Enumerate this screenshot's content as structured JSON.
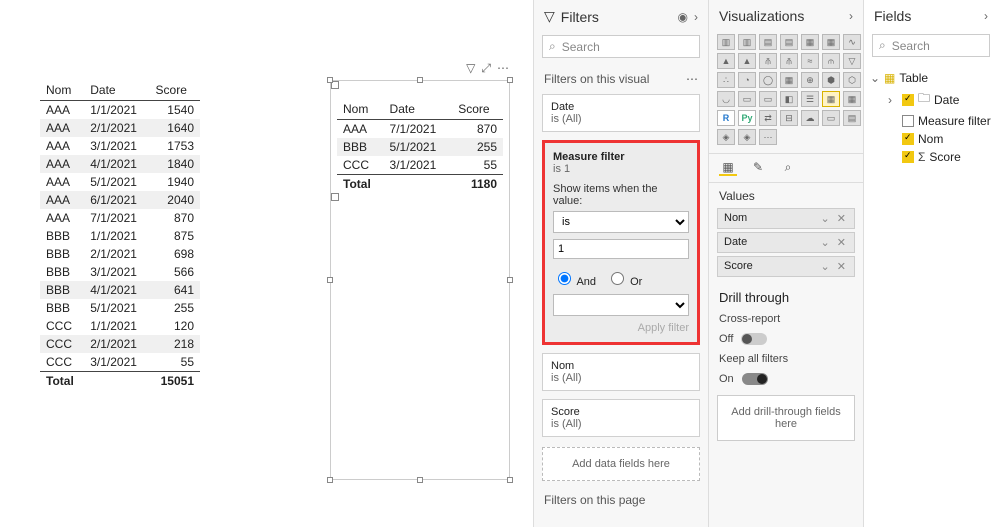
{
  "canvas": {
    "table1": {
      "headers": [
        "Nom",
        "Date",
        "Score"
      ],
      "rows": [
        [
          "AAA",
          "1/1/2021",
          "1540"
        ],
        [
          "AAA",
          "2/1/2021",
          "1640"
        ],
        [
          "AAA",
          "3/1/2021",
          "1753"
        ],
        [
          "AAA",
          "4/1/2021",
          "1840"
        ],
        [
          "AAA",
          "5/1/2021",
          "1940"
        ],
        [
          "AAA",
          "6/1/2021",
          "2040"
        ],
        [
          "AAA",
          "7/1/2021",
          "870"
        ],
        [
          "BBB",
          "1/1/2021",
          "875"
        ],
        [
          "BBB",
          "2/1/2021",
          "698"
        ],
        [
          "BBB",
          "3/1/2021",
          "566"
        ],
        [
          "BBB",
          "4/1/2021",
          "641"
        ],
        [
          "BBB",
          "5/1/2021",
          "255"
        ],
        [
          "CCC",
          "1/1/2021",
          "120"
        ],
        [
          "CCC",
          "2/1/2021",
          "218"
        ],
        [
          "CCC",
          "3/1/2021",
          "55"
        ]
      ],
      "alt_indices": [
        1,
        3,
        5,
        10,
        13
      ],
      "total_label": "Total",
      "total_value": "15051"
    },
    "table2": {
      "headers": [
        "Nom",
        "Date",
        "Score"
      ],
      "rows": [
        [
          "AAA",
          "7/1/2021",
          "870"
        ],
        [
          "BBB",
          "5/1/2021",
          "255"
        ],
        [
          "CCC",
          "3/1/2021",
          "55"
        ]
      ],
      "alt_indices": [
        1
      ],
      "total_label": "Total",
      "total_value": "1180"
    }
  },
  "filters": {
    "title": "Filters",
    "search_placeholder": "Search",
    "section_visual": "Filters on this visual",
    "section_page": "Filters on this page",
    "add_fields": "Add data fields here",
    "card_date": {
      "name": "Date",
      "cond": "is (All)"
    },
    "card_measure": {
      "name": "Measure filter",
      "cond": "is 1",
      "show_label": "Show items when the value:",
      "op": "is",
      "value": "1",
      "and_label": "And",
      "or_label": "Or",
      "apply": "Apply filter"
    },
    "card_nom": {
      "name": "Nom",
      "cond": "is (All)"
    },
    "card_score": {
      "name": "Score",
      "cond": "is (All)"
    }
  },
  "visualizations": {
    "title": "Visualizations",
    "values_label": "Values",
    "wells": [
      "Nom",
      "Date",
      "Score"
    ],
    "drill_title": "Drill through",
    "cross_label": "Cross-report",
    "cross_state": "Off",
    "keep_label": "Keep all filters",
    "keep_state": "On",
    "drill_drop": "Add drill-through fields here"
  },
  "fields": {
    "title": "Fields",
    "search_placeholder": "Search",
    "table_name": "Table",
    "items": [
      {
        "label": "Date",
        "checked": true,
        "caret": true
      },
      {
        "label": "Measure filter",
        "checked": false
      },
      {
        "label": "Nom",
        "checked": true
      },
      {
        "label": "Score",
        "checked": true,
        "sigma": true
      }
    ]
  }
}
